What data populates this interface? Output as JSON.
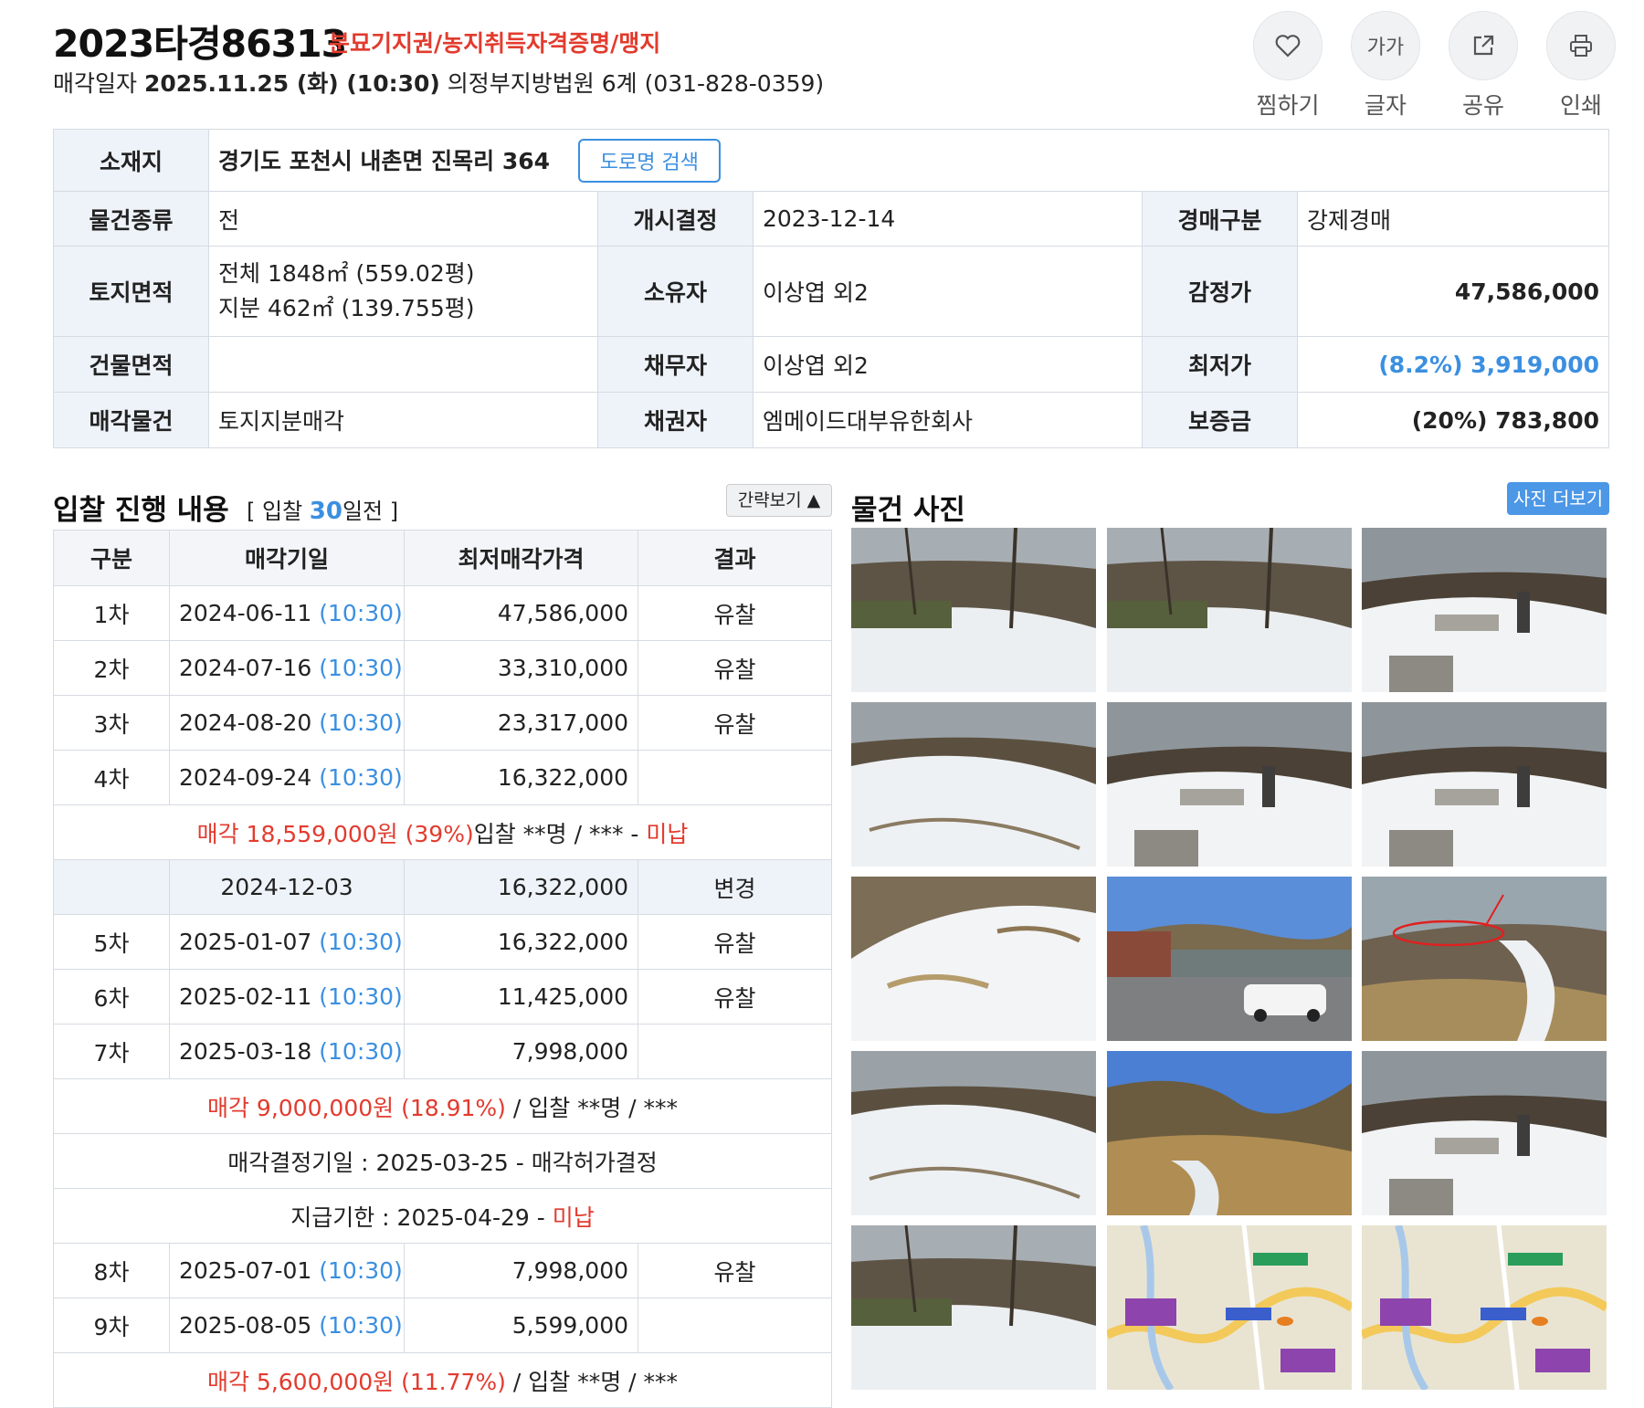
{
  "header": {
    "case_number": "2023타경86313",
    "tags": "분묘기지권/농지취득자격증명/맹지",
    "sale_label": "매각일자",
    "sale_datetime": "2025.11.25 (화) (10:30)",
    "court": "의정부지방법원 6계 (031-828-0359)"
  },
  "tools": [
    {
      "icon": "heart-icon",
      "label": "찜하기"
    },
    {
      "icon": "text-size-icon",
      "glyph": "가가",
      "label": "글자"
    },
    {
      "icon": "share-icon",
      "label": "공유"
    },
    {
      "icon": "print-icon",
      "label": "인쇄"
    }
  ],
  "info": {
    "location_label": "소재지",
    "location": "경기도 포천시 내촌면 진목리 364",
    "road_button": "도로명 검색",
    "rows": [
      {
        "h1": "물건종류",
        "v1": "전",
        "h2": "개시결정",
        "v2": "2023-12-14",
        "h3": "경매구분",
        "v3": "강제경매"
      },
      {
        "h1": "토지면적",
        "v1": "전체 1848㎡ (559.02평)",
        "v1b": "지분 462㎡ (139.755평)",
        "h2": "소유자",
        "v2": "이상엽 외2",
        "h3": "감정가",
        "v3": "47,586,000"
      },
      {
        "h1": "건물면적",
        "v1": "",
        "h2": "채무자",
        "v2": "이상엽 외2",
        "h3": "최저가",
        "v3": "(8.2%) 3,919,000"
      },
      {
        "h1": "매각물건",
        "v1": "토지지분매각",
        "h2": "채권자",
        "v2": "엠메이드대부유한회사",
        "h3": "보증금",
        "v3": "(20%) 783,800"
      }
    ]
  },
  "bids": {
    "title": "입찰 진행 내용",
    "sub_prefix": "[ 입찰 ",
    "sub_days": "30",
    "sub_suffix": "일전 ]",
    "brief_button": "간략보기 ▲",
    "headers": [
      "구분",
      "매각기일",
      "최저매각가격",
      "결과"
    ],
    "rows": [
      {
        "round": "1차",
        "date": "2024-06-11",
        "time": "(10:30)",
        "price": "47,586,000",
        "result": "유찰"
      },
      {
        "round": "2차",
        "date": "2024-07-16",
        "time": "(10:30)",
        "price": "33,310,000",
        "result": "유찰"
      },
      {
        "round": "3차",
        "date": "2024-08-20",
        "time": "(10:30)",
        "price": "23,317,000",
        "result": "유찰"
      },
      {
        "round": "4차",
        "date": "2024-09-24",
        "time": "(10:30)",
        "price": "16,322,000",
        "result": ""
      }
    ],
    "note1": {
      "red1": "매각 18,559,000원 (39%)",
      "black": "입찰 **명 / *** - ",
      "red2": "미납"
    },
    "alt_row": {
      "date": "2024-12-03",
      "price": "16,322,000",
      "result": "변경"
    },
    "rows2": [
      {
        "round": "5차",
        "date": "2025-01-07",
        "time": "(10:30)",
        "price": "16,322,000",
        "result": "유찰"
      },
      {
        "round": "6차",
        "date": "2025-02-11",
        "time": "(10:30)",
        "price": "11,425,000",
        "result": "유찰"
      },
      {
        "round": "7차",
        "date": "2025-03-18",
        "time": "(10:30)",
        "price": "7,998,000",
        "result": ""
      }
    ],
    "note2": {
      "red": "매각 9,000,000원 (18.91%)",
      "black": " / 입찰 **명 / ***"
    },
    "note3": "매각결정기일 : 2025-03-25 - 매각허가결정",
    "note4": {
      "black": "지급기한 : 2025-04-29 - ",
      "red": "미납"
    },
    "rows3": [
      {
        "round": "8차",
        "date": "2025-07-01",
        "time": "(10:30)",
        "price": "7,998,000",
        "result": "유찰"
      },
      {
        "round": "9차",
        "date": "2025-08-05",
        "time": "(10:30)",
        "price": "5,599,000",
        "result": ""
      }
    ],
    "note5": {
      "red": "매각 5,600,000원 (11.77%)",
      "black": " / 입찰 **명 / ***"
    }
  },
  "photos": {
    "title": "물건 사진",
    "more_button": "사진 더보기",
    "items": [
      {
        "kind": "snow-forest"
      },
      {
        "kind": "snow-forest"
      },
      {
        "kind": "grave"
      },
      {
        "kind": "snow-slope"
      },
      {
        "kind": "grave"
      },
      {
        "kind": "grave"
      },
      {
        "kind": "snow-mound"
      },
      {
        "kind": "building-parking"
      },
      {
        "kind": "annotated"
      },
      {
        "kind": "snow-slope"
      },
      {
        "kind": "dry-valley"
      },
      {
        "kind": "grave"
      },
      {
        "kind": "snow-forest"
      },
      {
        "kind": "map"
      },
      {
        "kind": "map"
      }
    ]
  }
}
